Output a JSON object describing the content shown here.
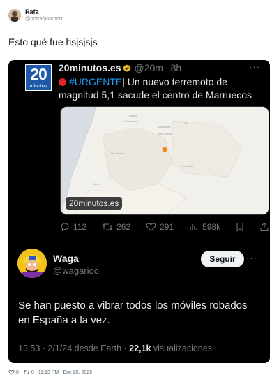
{
  "outer_tweet": {
    "display_name": "Rafa",
    "handle": "@notrafalacoort",
    "text": "Esto qué fue hsjsjsjs",
    "likes": "0",
    "retweets": "0",
    "timestamp": "11:13 PM - Ene 25, 2025"
  },
  "quoted_tweet": {
    "logo_number": "20",
    "logo_word": "minutos",
    "name": "20minutos.es",
    "handle": "@20m",
    "time": "8h",
    "hashtag": "#URGENTE",
    "text": "| Un nuevo terremoto de magnitud 5,1 sacude el centro de Marruecos",
    "media_tag": "20minutos.es",
    "map_labels": [
      "Rabat",
      "Casablanca",
      "Marrakech",
      "Mequinez",
      "Fez",
      "Beni Mellal",
      "Errachidia",
      "Tiznit"
    ],
    "actions": {
      "replies": "112",
      "retweets": "262",
      "likes": "291",
      "views": "598k"
    }
  },
  "reply": {
    "name": "Waga",
    "handle": "@wagarioo",
    "follow_label": "Seguir",
    "text": "Se han puesto a vibrar todos los móviles robados en España a la vez.",
    "meta": "13:53 · 2/1/24 desde Earth · ",
    "views_count": "22,1k",
    "views_label": " visualizaciones"
  },
  "colors": {
    "card_bg": "#000000",
    "accent_blue": "#1d9bf0",
    "logo_blue": "#1d59a8",
    "urgent_red": "#e0242c",
    "muted": "#71767b",
    "epicenter": "#f28a1a"
  }
}
